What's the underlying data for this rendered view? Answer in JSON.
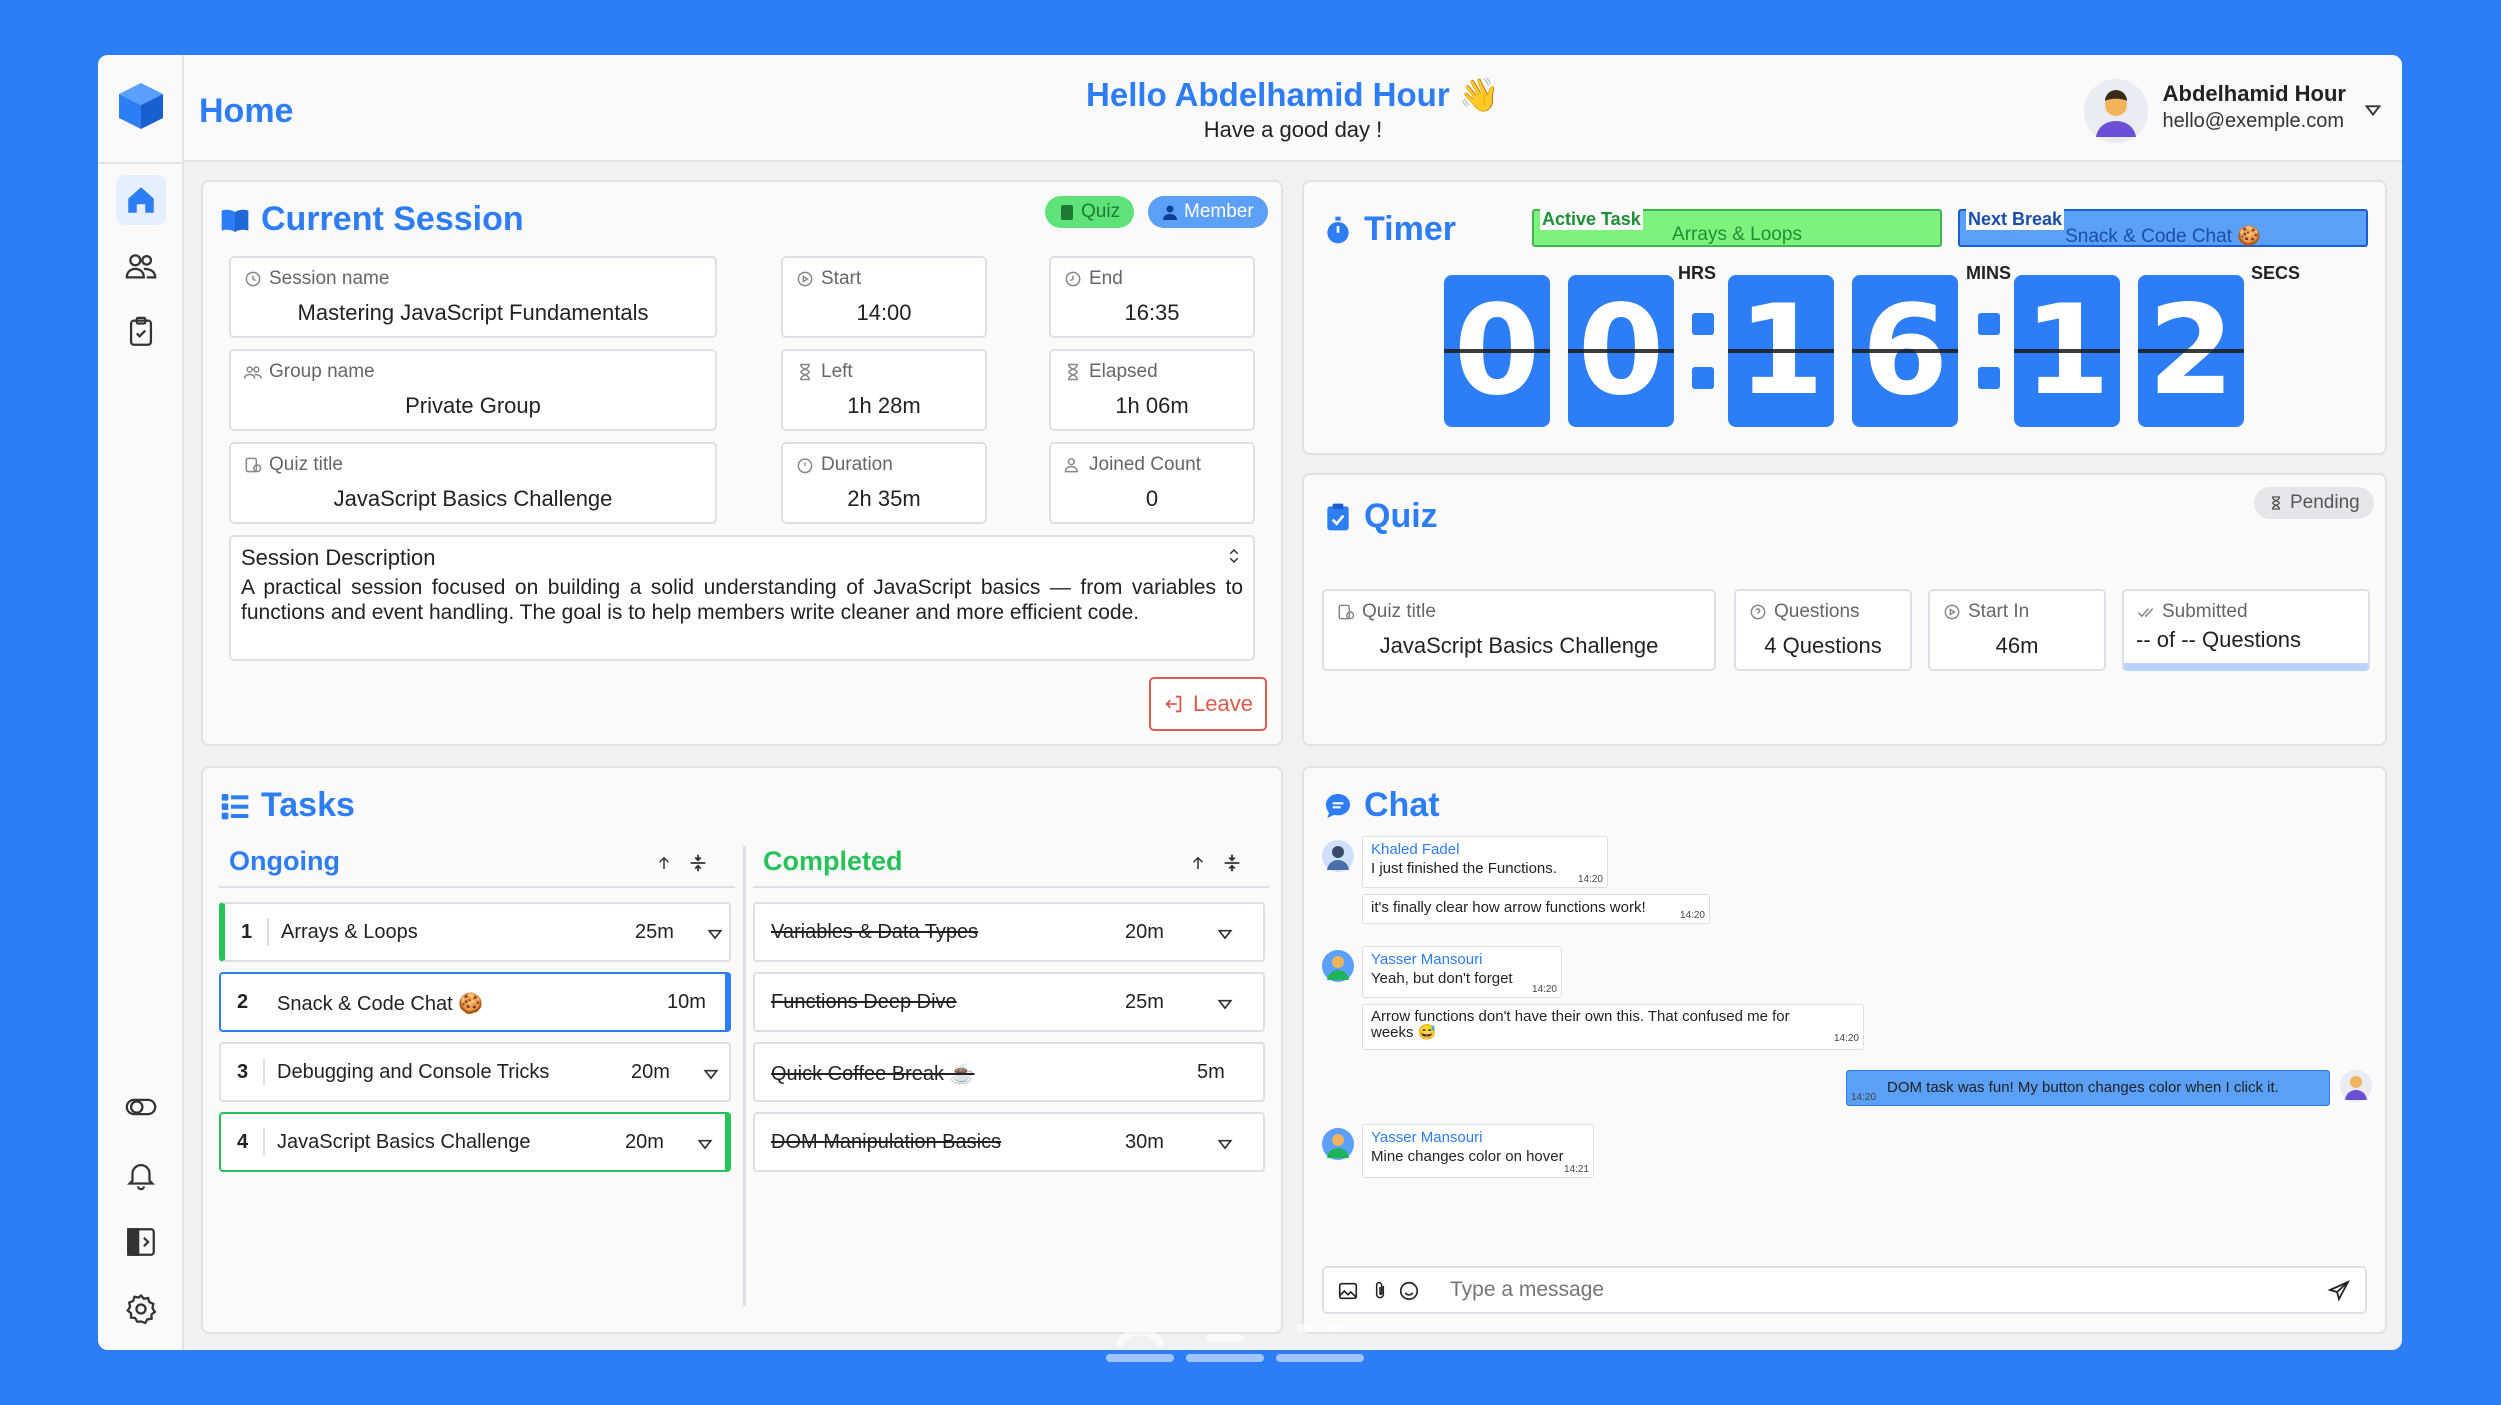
{
  "header": {
    "page_title": "Home",
    "greeting": "Hello Abdelhamid Hour 👋",
    "subtitle": "Have a good day !",
    "user_name": "Abdelhamid Hour",
    "user_email": "hello@exemple.com"
  },
  "colors": {
    "accent": "#2d7df6",
    "success": "#27c25a",
    "danger": "#e05a4a",
    "background": "#f0f1f3"
  },
  "session": {
    "title": "Current Session",
    "badge_quiz": "Quiz",
    "badge_member": "Member",
    "session_name_label": "Session name",
    "session_name": "Mastering JavaScript Fundamentals",
    "group_name_label": "Group name",
    "group_name": "Private Group",
    "quiz_title_label": "Quiz title",
    "quiz_title": "JavaScript Basics Challenge",
    "start_label": "Start",
    "start": "14:00",
    "end_label": "End",
    "end": "16:35",
    "left_label": "Left",
    "left": "1h 28m",
    "elapsed_label": "Elapsed",
    "elapsed": "1h 06m",
    "duration_label": "Duration",
    "duration": "2h 35m",
    "joined_label": "Joined Count",
    "joined": "0",
    "description_label": "Session Description",
    "description": "A practical session focused on building a solid understanding of JavaScript basics — from variables to functions and event handling. The goal is to help members write cleaner and more efficient code.",
    "leave_label": "Leave"
  },
  "timer": {
    "title": "Timer",
    "active_task_label": "Active Task",
    "active_task": "Arrays & Loops",
    "next_break_label": "Next Break",
    "next_break": "Snack & Code Chat 🍪",
    "hrs_label": "HRS",
    "mins_label": "MINS",
    "secs_label": "SECS",
    "h1": "0",
    "h2": "0",
    "m1": "1",
    "m2": "6",
    "s1": "1",
    "s2": "2"
  },
  "quiz": {
    "title": "Quiz",
    "status": "Pending",
    "quiz_title_label": "Quiz title",
    "quiz_title": "JavaScript Basics Challenge",
    "questions_label": "Questions",
    "questions": "4 Questions",
    "start_in_label": "Start In",
    "start_in": "46m",
    "submitted_label": "Submitted",
    "submitted": "-- of -- Questions"
  },
  "tasks": {
    "title": "Tasks",
    "ongoing_label": "Ongoing",
    "completed_label": "Completed",
    "ongoing": [
      {
        "num": "1",
        "name": "Arrays & Loops",
        "duration": "25m"
      },
      {
        "num": "2",
        "name": "Snack & Code Chat 🍪",
        "duration": "10m"
      },
      {
        "num": "3",
        "name": "Debugging and Console Tricks",
        "duration": "20m"
      },
      {
        "num": "4",
        "name": "JavaScript Basics Challenge",
        "duration": "20m"
      }
    ],
    "completed": [
      {
        "name": "Variables & Data Types",
        "duration": "20m"
      },
      {
        "name": "Functions Deep Dive",
        "duration": "25m"
      },
      {
        "name": "Quick Coffee Break ☕",
        "duration": "5m"
      },
      {
        "name": "DOM Manipulation Basics",
        "duration": "30m"
      }
    ]
  },
  "chat": {
    "title": "Chat",
    "messages": [
      {
        "sender": "Khaled Fadel",
        "text": "I just finished the Functions.",
        "time": "14:20"
      },
      {
        "sender": "",
        "text": "it's finally clear how arrow functions work!",
        "time": "14:20"
      },
      {
        "sender": "Yasser Mansouri",
        "text": "Yeah, but don't forget",
        "time": "14:20"
      },
      {
        "sender": "",
        "text": "Arrow functions don't have their own this. That confused me for weeks 😅",
        "time": "14:20"
      },
      {
        "sender": "",
        "text": "DOM task was fun! My button changes color when I click it.",
        "time": "14:20"
      },
      {
        "sender": "Yasser Mansouri",
        "text": "Mine changes color on hover",
        "time": "14:21"
      }
    ],
    "input_placeholder": "Type a message"
  }
}
